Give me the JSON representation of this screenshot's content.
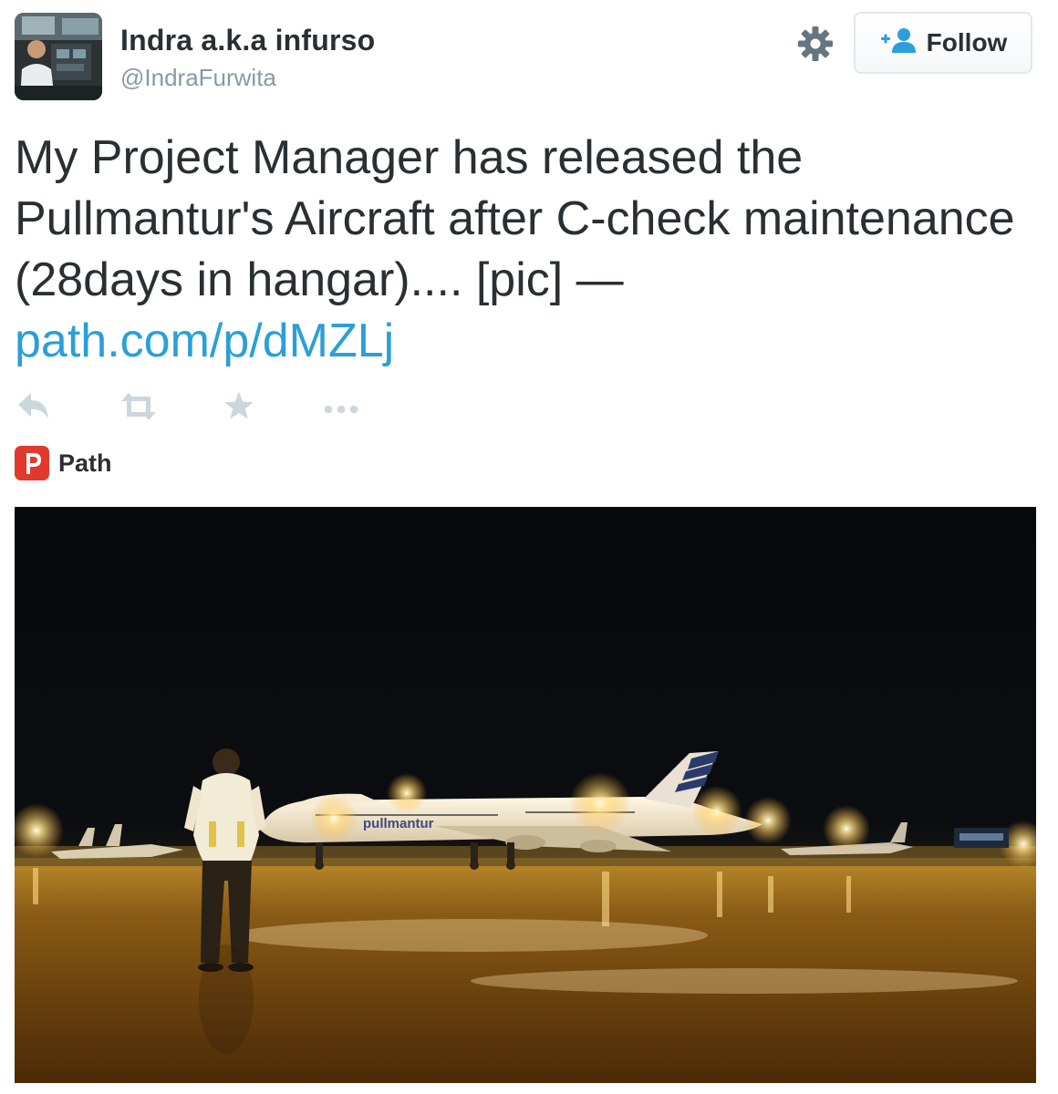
{
  "user": {
    "display_name": "Indra a.k.a infurso",
    "handle": "@IndraFurwita"
  },
  "follow_button": {
    "label": "Follow",
    "icon": "add-user-icon"
  },
  "settings": {
    "icon": "gear-icon"
  },
  "tweet": {
    "text": "My Project Manager has released the Pullmantur's Aircraft after C-check maintenance (28days in hangar).... [pic] —",
    "link": "path.com/p/dMZLj"
  },
  "actions": [
    "reply-icon",
    "retweet-icon",
    "favorite-icon",
    "more-icon"
  ],
  "source": {
    "label": "Path",
    "icon": "path-logo-icon"
  },
  "photo": {
    "livery_text": "pullmantur"
  },
  "colors": {
    "text": "#292f33",
    "muted": "#8899a6",
    "link": "#2b9fd8",
    "path_brand": "#e0392e",
    "action_icon": "#ccd6dd"
  }
}
